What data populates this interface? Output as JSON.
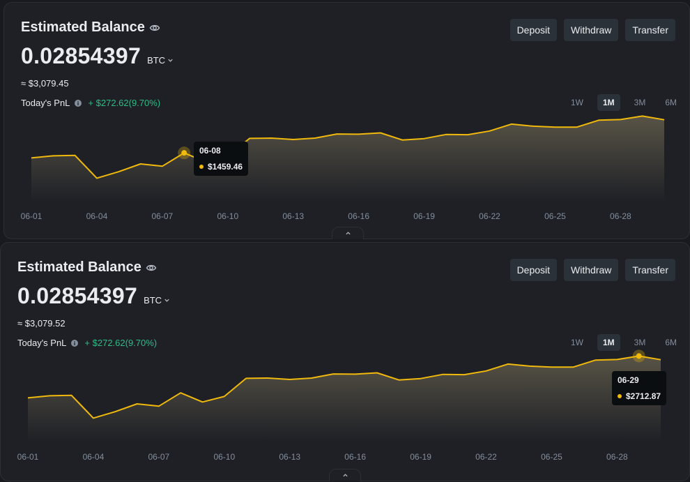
{
  "panels": [
    {
      "title": "Estimated Balance",
      "amount": "0.02854397",
      "unit": "BTC",
      "approx": "≈ $3,079.45",
      "pnl_label": "Today's PnL",
      "pnl_value": "+ $272.62(9.70%)",
      "buttons": [
        "Deposit",
        "Withdraw",
        "Transfer"
      ],
      "ranges": [
        "1W",
        "1M",
        "3M",
        "6M"
      ],
      "active_range": "1M",
      "tooltip": {
        "date": "06-08",
        "value": "$1459.46"
      }
    },
    {
      "title": "Estimated Balance",
      "amount": "0.02854397",
      "unit": "BTC",
      "approx": "≈ $3,079.52",
      "pnl_label": "Today's PnL",
      "pnl_value": "+ $272.62(9.70%)",
      "buttons": [
        "Deposit",
        "Withdraw",
        "Transfer"
      ],
      "ranges": [
        "1W",
        "1M",
        "3M",
        "6M"
      ],
      "active_range": "1M",
      "tooltip": {
        "date": "06-29",
        "value": "$2712.87"
      }
    }
  ],
  "chart_data": {
    "type": "area",
    "x": [
      "06-01",
      "06-02",
      "06-03",
      "06-04",
      "06-05",
      "06-06",
      "06-07",
      "06-08",
      "06-09",
      "06-10",
      "06-11",
      "06-12",
      "06-13",
      "06-14",
      "06-15",
      "06-16",
      "06-17",
      "06-18",
      "06-19",
      "06-20",
      "06-21",
      "06-22",
      "06-23",
      "06-24",
      "06-25",
      "06-26",
      "06-27",
      "06-28",
      "06-29",
      "06-30"
    ],
    "x_tick_labels": [
      "06-01",
      "06-04",
      "06-07",
      "06-10",
      "06-13",
      "06-16",
      "06-19",
      "06-22",
      "06-25",
      "06-28"
    ],
    "values": [
      1350,
      1395,
      1405,
      910,
      1050,
      1220,
      1170,
      1459.46,
      1260,
      1380,
      1775,
      1780,
      1750,
      1780,
      1870,
      1865,
      1895,
      1740,
      1770,
      1860,
      1855,
      1935,
      2085,
      2040,
      2020,
      2020,
      2170,
      2185,
      2260,
      2180
    ],
    "ylim": [
      400,
      2600
    ],
    "highlight_index": [
      7,
      28
    ],
    "colors": {
      "line": "#f0b90b",
      "up": "#2ebd85"
    }
  },
  "icons": {
    "eye": "eye-icon",
    "chevron": "chevron-down-icon",
    "info": "info-icon",
    "collapse": "chevron-up-icon"
  }
}
